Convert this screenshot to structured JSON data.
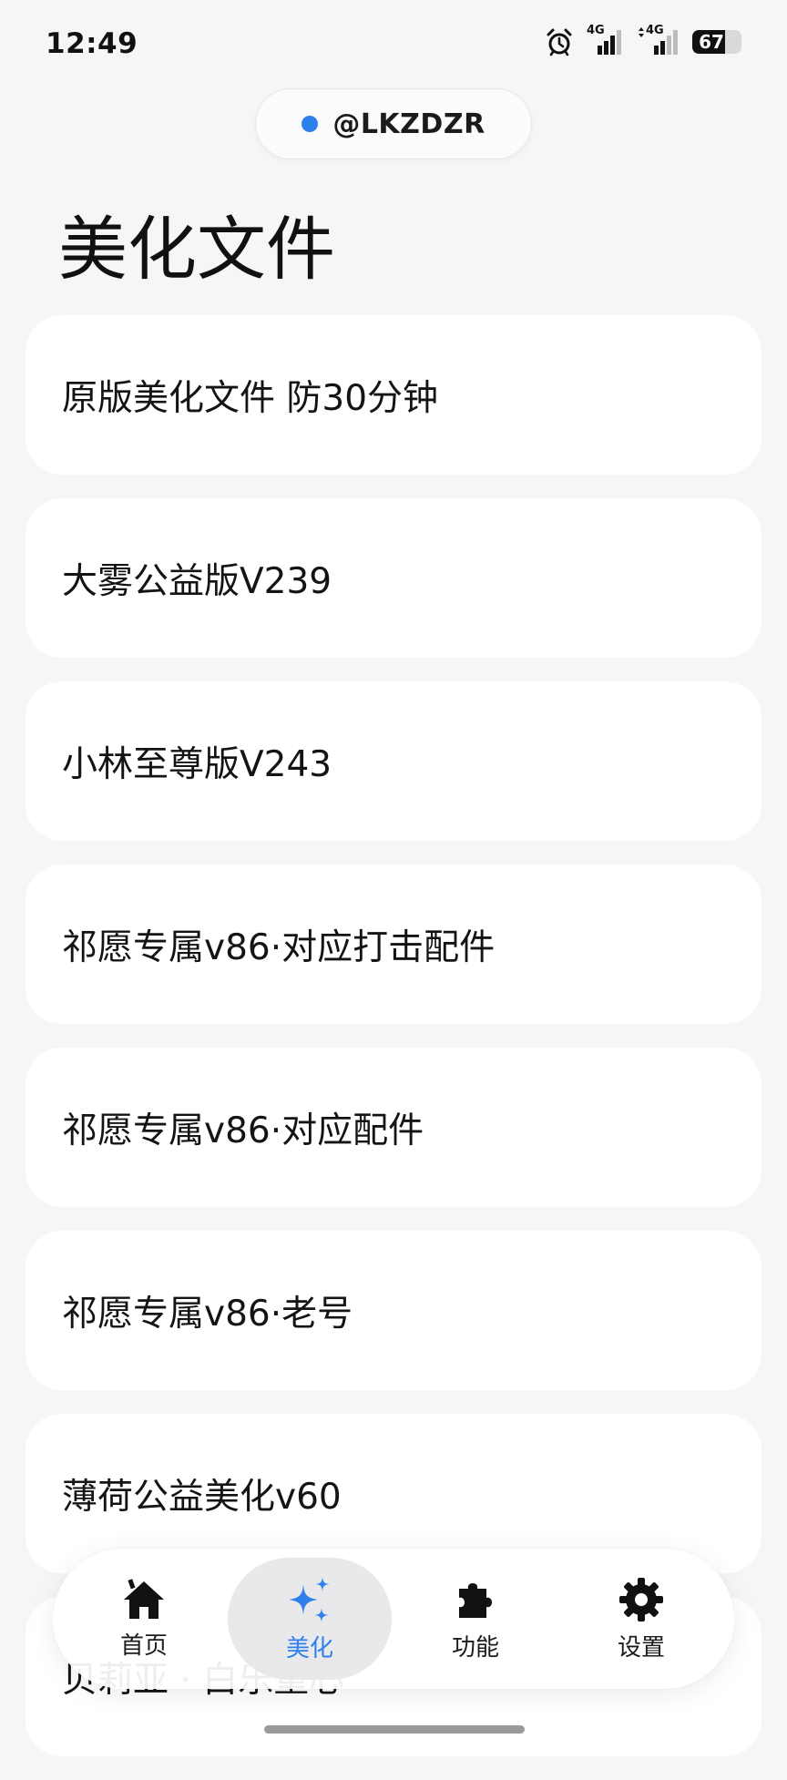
{
  "status_bar": {
    "time": "12:49",
    "net1": "4G",
    "net2": "4G",
    "battery": 67
  },
  "header": {
    "user_handle": "@LKZDZR",
    "accent_color": "#2f80ed"
  },
  "page": {
    "title": "美化文件"
  },
  "list": {
    "items": [
      {
        "label": "原版美化文件 防30分钟"
      },
      {
        "label": "大雾公益版V239"
      },
      {
        "label": "小林至尊版V243"
      },
      {
        "label": "祁愿专属v86·对应打击配件"
      },
      {
        "label": "祁愿专属v86·对应配件"
      },
      {
        "label": "祁愿专属v86·老号"
      },
      {
        "label": "薄荷公益美化v60"
      },
      {
        "label": "贝莉亚 · 白乐重心"
      }
    ]
  },
  "bottom_nav": {
    "items": [
      {
        "label": "首页",
        "icon": "home-icon"
      },
      {
        "label": "美化",
        "icon": "sparkle-icon",
        "active": true
      },
      {
        "label": "功能",
        "icon": "puzzle-icon"
      },
      {
        "label": "设置",
        "icon": "gear-icon"
      }
    ]
  }
}
